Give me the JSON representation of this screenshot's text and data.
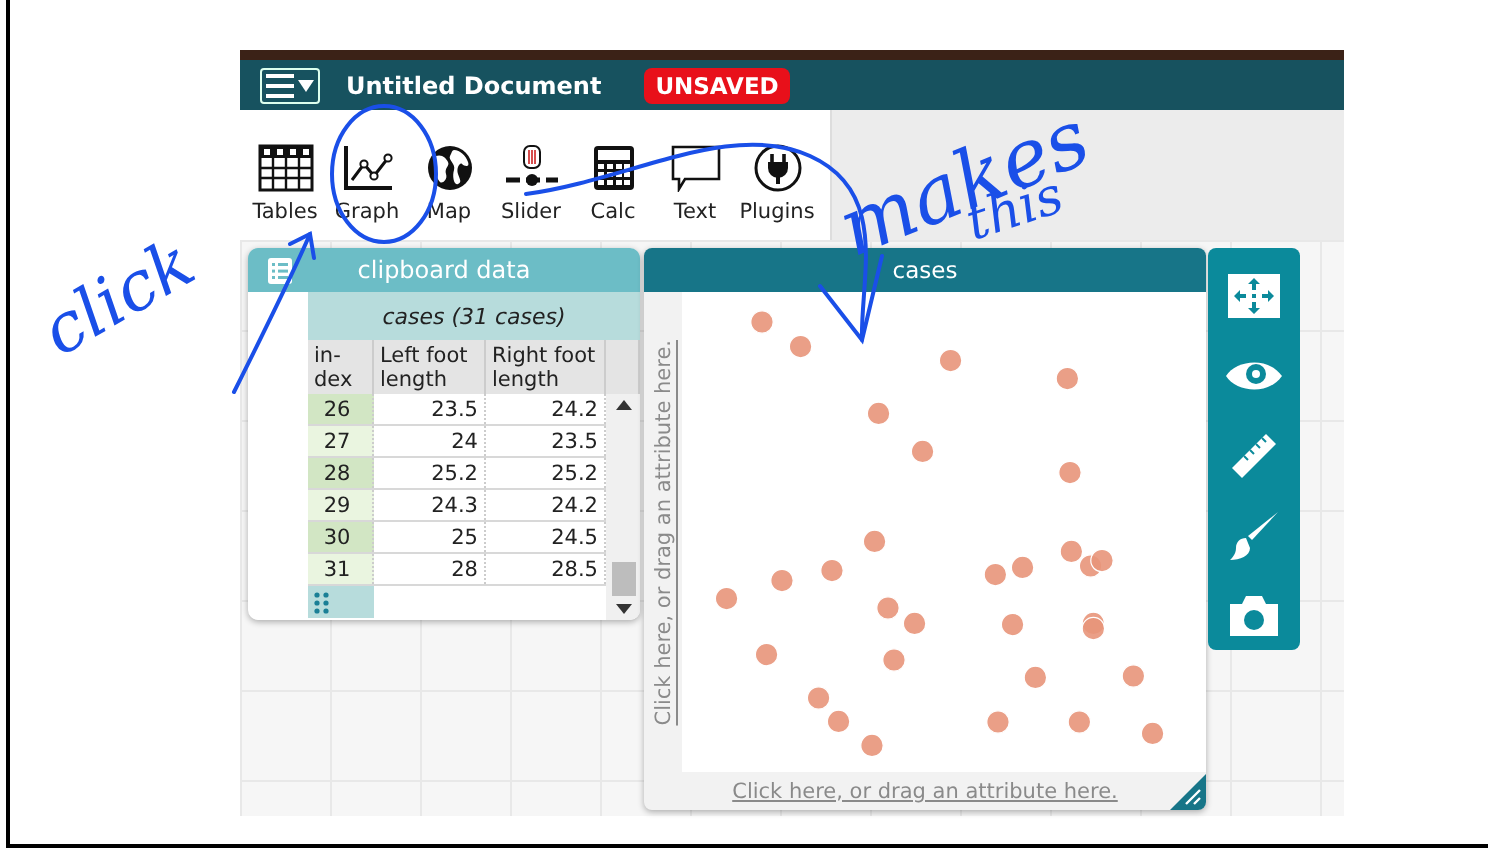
{
  "header": {
    "title": "Untitled Document",
    "status": "UNSAVED"
  },
  "tools": [
    {
      "label": "Tables",
      "kind": "table"
    },
    {
      "label": "Graph",
      "kind": "graph"
    },
    {
      "label": "Map",
      "kind": "map"
    },
    {
      "label": "Slider",
      "kind": "slider"
    },
    {
      "label": "Calc",
      "kind": "calc"
    },
    {
      "label": "Text",
      "kind": "text"
    },
    {
      "label": "Plugins",
      "kind": "plugins"
    }
  ],
  "table": {
    "title": "clipboard data",
    "collection": "cases (31 cases)",
    "columns": [
      "in-dex",
      "Left foot length",
      "Right foot length"
    ],
    "rows": [
      [
        "26",
        "23.5",
        "24.2"
      ],
      [
        "27",
        "24",
        "23.5"
      ],
      [
        "28",
        "25.2",
        "25.2"
      ],
      [
        "29",
        "24.3",
        "24.2"
      ],
      [
        "30",
        "25",
        "24.5"
      ],
      [
        "31",
        "28",
        "28.5"
      ]
    ]
  },
  "graph": {
    "title": "cases",
    "y_axis_prompt": "Click here, or drag an attribute here.",
    "x_axis_prompt": "Click here, or drag an attribute here."
  },
  "graph_tools": [
    {
      "kind": "move"
    },
    {
      "kind": "eye"
    },
    {
      "kind": "ruler"
    },
    {
      "kind": "brush"
    },
    {
      "kind": "camera"
    }
  ],
  "handwriting": [
    {
      "text": "click"
    },
    {
      "text": "makes"
    },
    {
      "text": "this"
    }
  ]
}
